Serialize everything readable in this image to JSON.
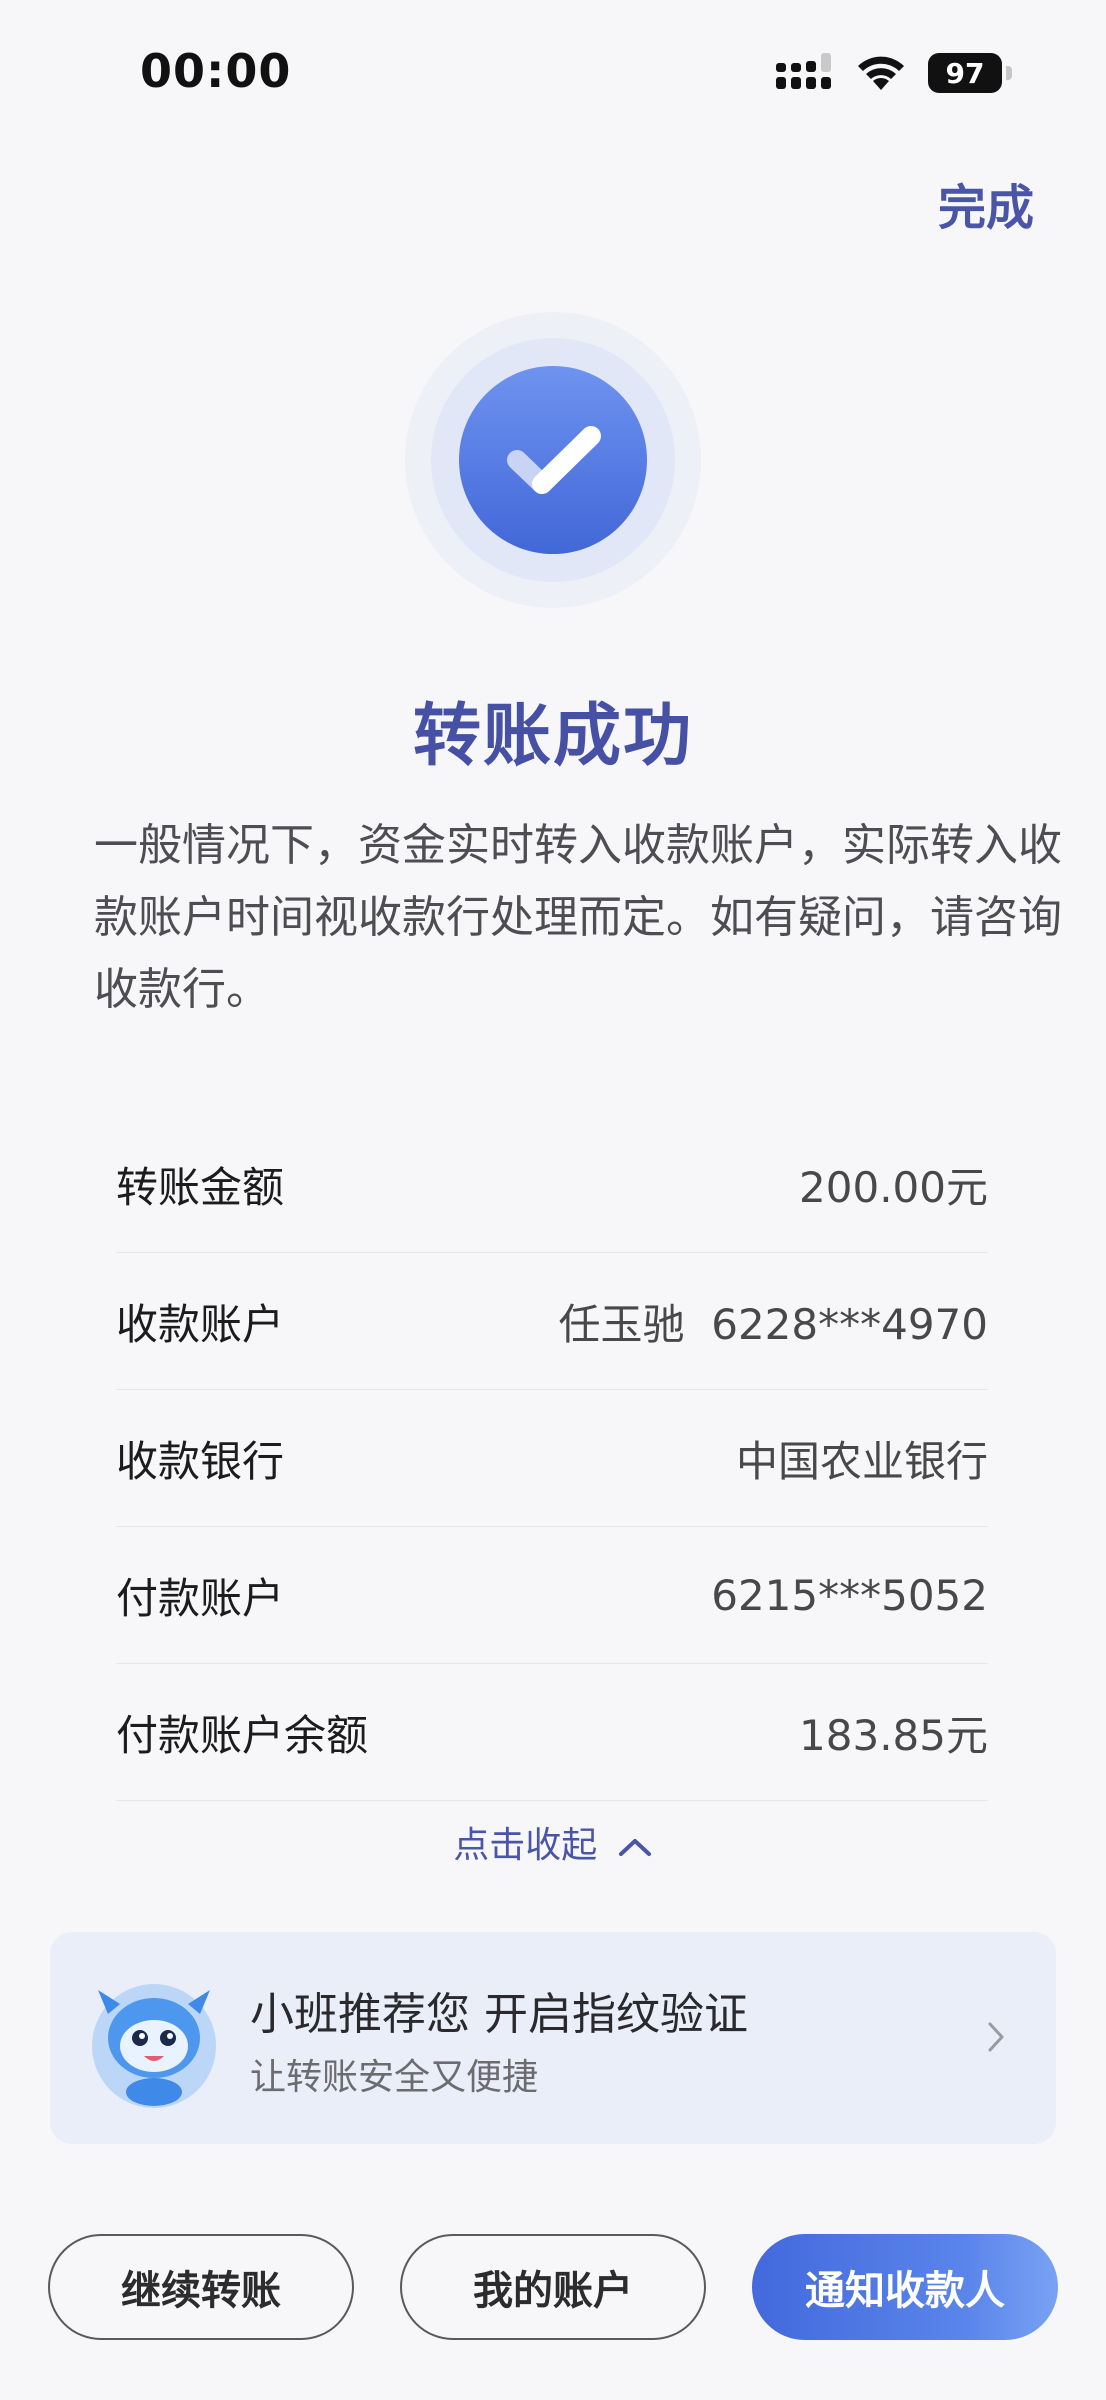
{
  "status_bar": {
    "time": "00:00",
    "battery": "97",
    "icons": [
      "signal-icon",
      "wifi-icon",
      "battery-icon"
    ]
  },
  "header": {
    "done_label": "完成"
  },
  "result": {
    "icon": "check-circle-icon",
    "title": "转账成功",
    "notice": "一般情况下，资金实时转入收款账户，实际转入收款账户时间视收款行处理而定。如有疑问，请咨询收款行。"
  },
  "details": [
    {
      "label": "转账金额",
      "value": "200.00元"
    },
    {
      "label": "收款账户",
      "value": "任玉驰  6228***4970"
    },
    {
      "label": "收款银行",
      "value": "中国农业银行"
    },
    {
      "label": "付款账户",
      "value": "6215***5052"
    },
    {
      "label": "付款账户余额",
      "value": "183.85元"
    }
  ],
  "collapse_label": "点击收起",
  "promo": {
    "title": "小班推荐您 开启指纹验证",
    "subtitle": "让转账安全又便捷",
    "icon": "mascot-icon"
  },
  "buttons": {
    "continue_transfer": "继续转账",
    "my_account": "我的账户",
    "notify_payee": "通知收款人"
  },
  "colors": {
    "accent": "#4a55a8",
    "primary_button": "#4a71e0",
    "background": "#f7f7f9",
    "promo_card": "#e9eef8"
  }
}
